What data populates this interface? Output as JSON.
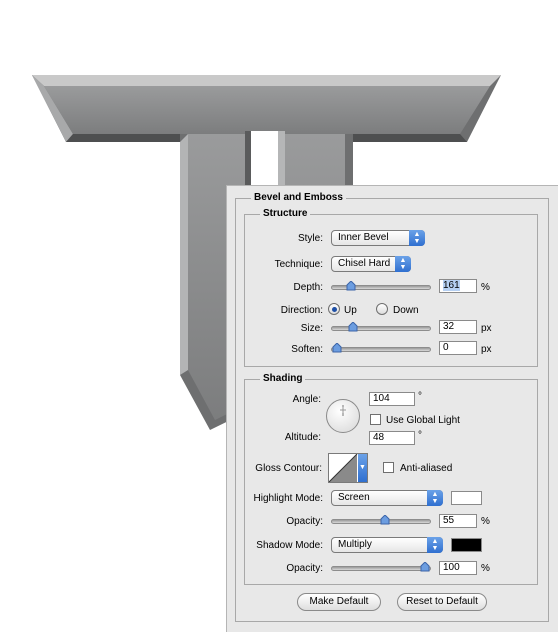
{
  "panel_title": "Bevel and Emboss",
  "structure": {
    "title": "Structure",
    "style_label": "Style:",
    "style_value": "Inner Bevel",
    "technique_label": "Technique:",
    "technique_value": "Chisel Hard",
    "depth_label": "Depth:",
    "depth_value": "161",
    "depth_unit": "%",
    "depth_slider_fraction": 0.16,
    "direction_label": "Direction:",
    "direction_up": "Up",
    "direction_down": "Down",
    "direction_selected": "Up",
    "size_label": "Size:",
    "size_value": "32",
    "size_unit": "px",
    "size_slider_fraction": 0.18,
    "soften_label": "Soften:",
    "soften_value": "0",
    "soften_unit": "px",
    "soften_slider_fraction": 0.0
  },
  "shading": {
    "title": "Shading",
    "angle_label": "Angle:",
    "angle_value": "104",
    "angle_unit": "°",
    "use_global_light_label": "Use Global Light",
    "use_global_light_checked": false,
    "altitude_label": "Altitude:",
    "altitude_value": "48",
    "altitude_unit": "°",
    "gloss_contour_label": "Gloss Contour:",
    "anti_aliased_label": "Anti-aliased",
    "anti_aliased_checked": false,
    "highlight_mode_label": "Highlight Mode:",
    "highlight_mode_value": "Screen",
    "highlight_color": "#ffffff",
    "highlight_opacity_label": "Opacity:",
    "highlight_opacity_value": "55",
    "highlight_opacity_unit": "%",
    "highlight_opacity_fraction": 0.55,
    "shadow_mode_label": "Shadow Mode:",
    "shadow_mode_value": "Multiply",
    "shadow_color": "#000000",
    "shadow_opacity_label": "Opacity:",
    "shadow_opacity_value": "100",
    "shadow_opacity_unit": "%",
    "shadow_opacity_fraction": 1.0
  },
  "buttons": {
    "make_default": "Make Default",
    "reset_default": "Reset to Default"
  },
  "colors": {
    "letter_face": "#8a8b8c",
    "panel_bg": "#e8e8e8",
    "accent": "#2f6fd0"
  }
}
